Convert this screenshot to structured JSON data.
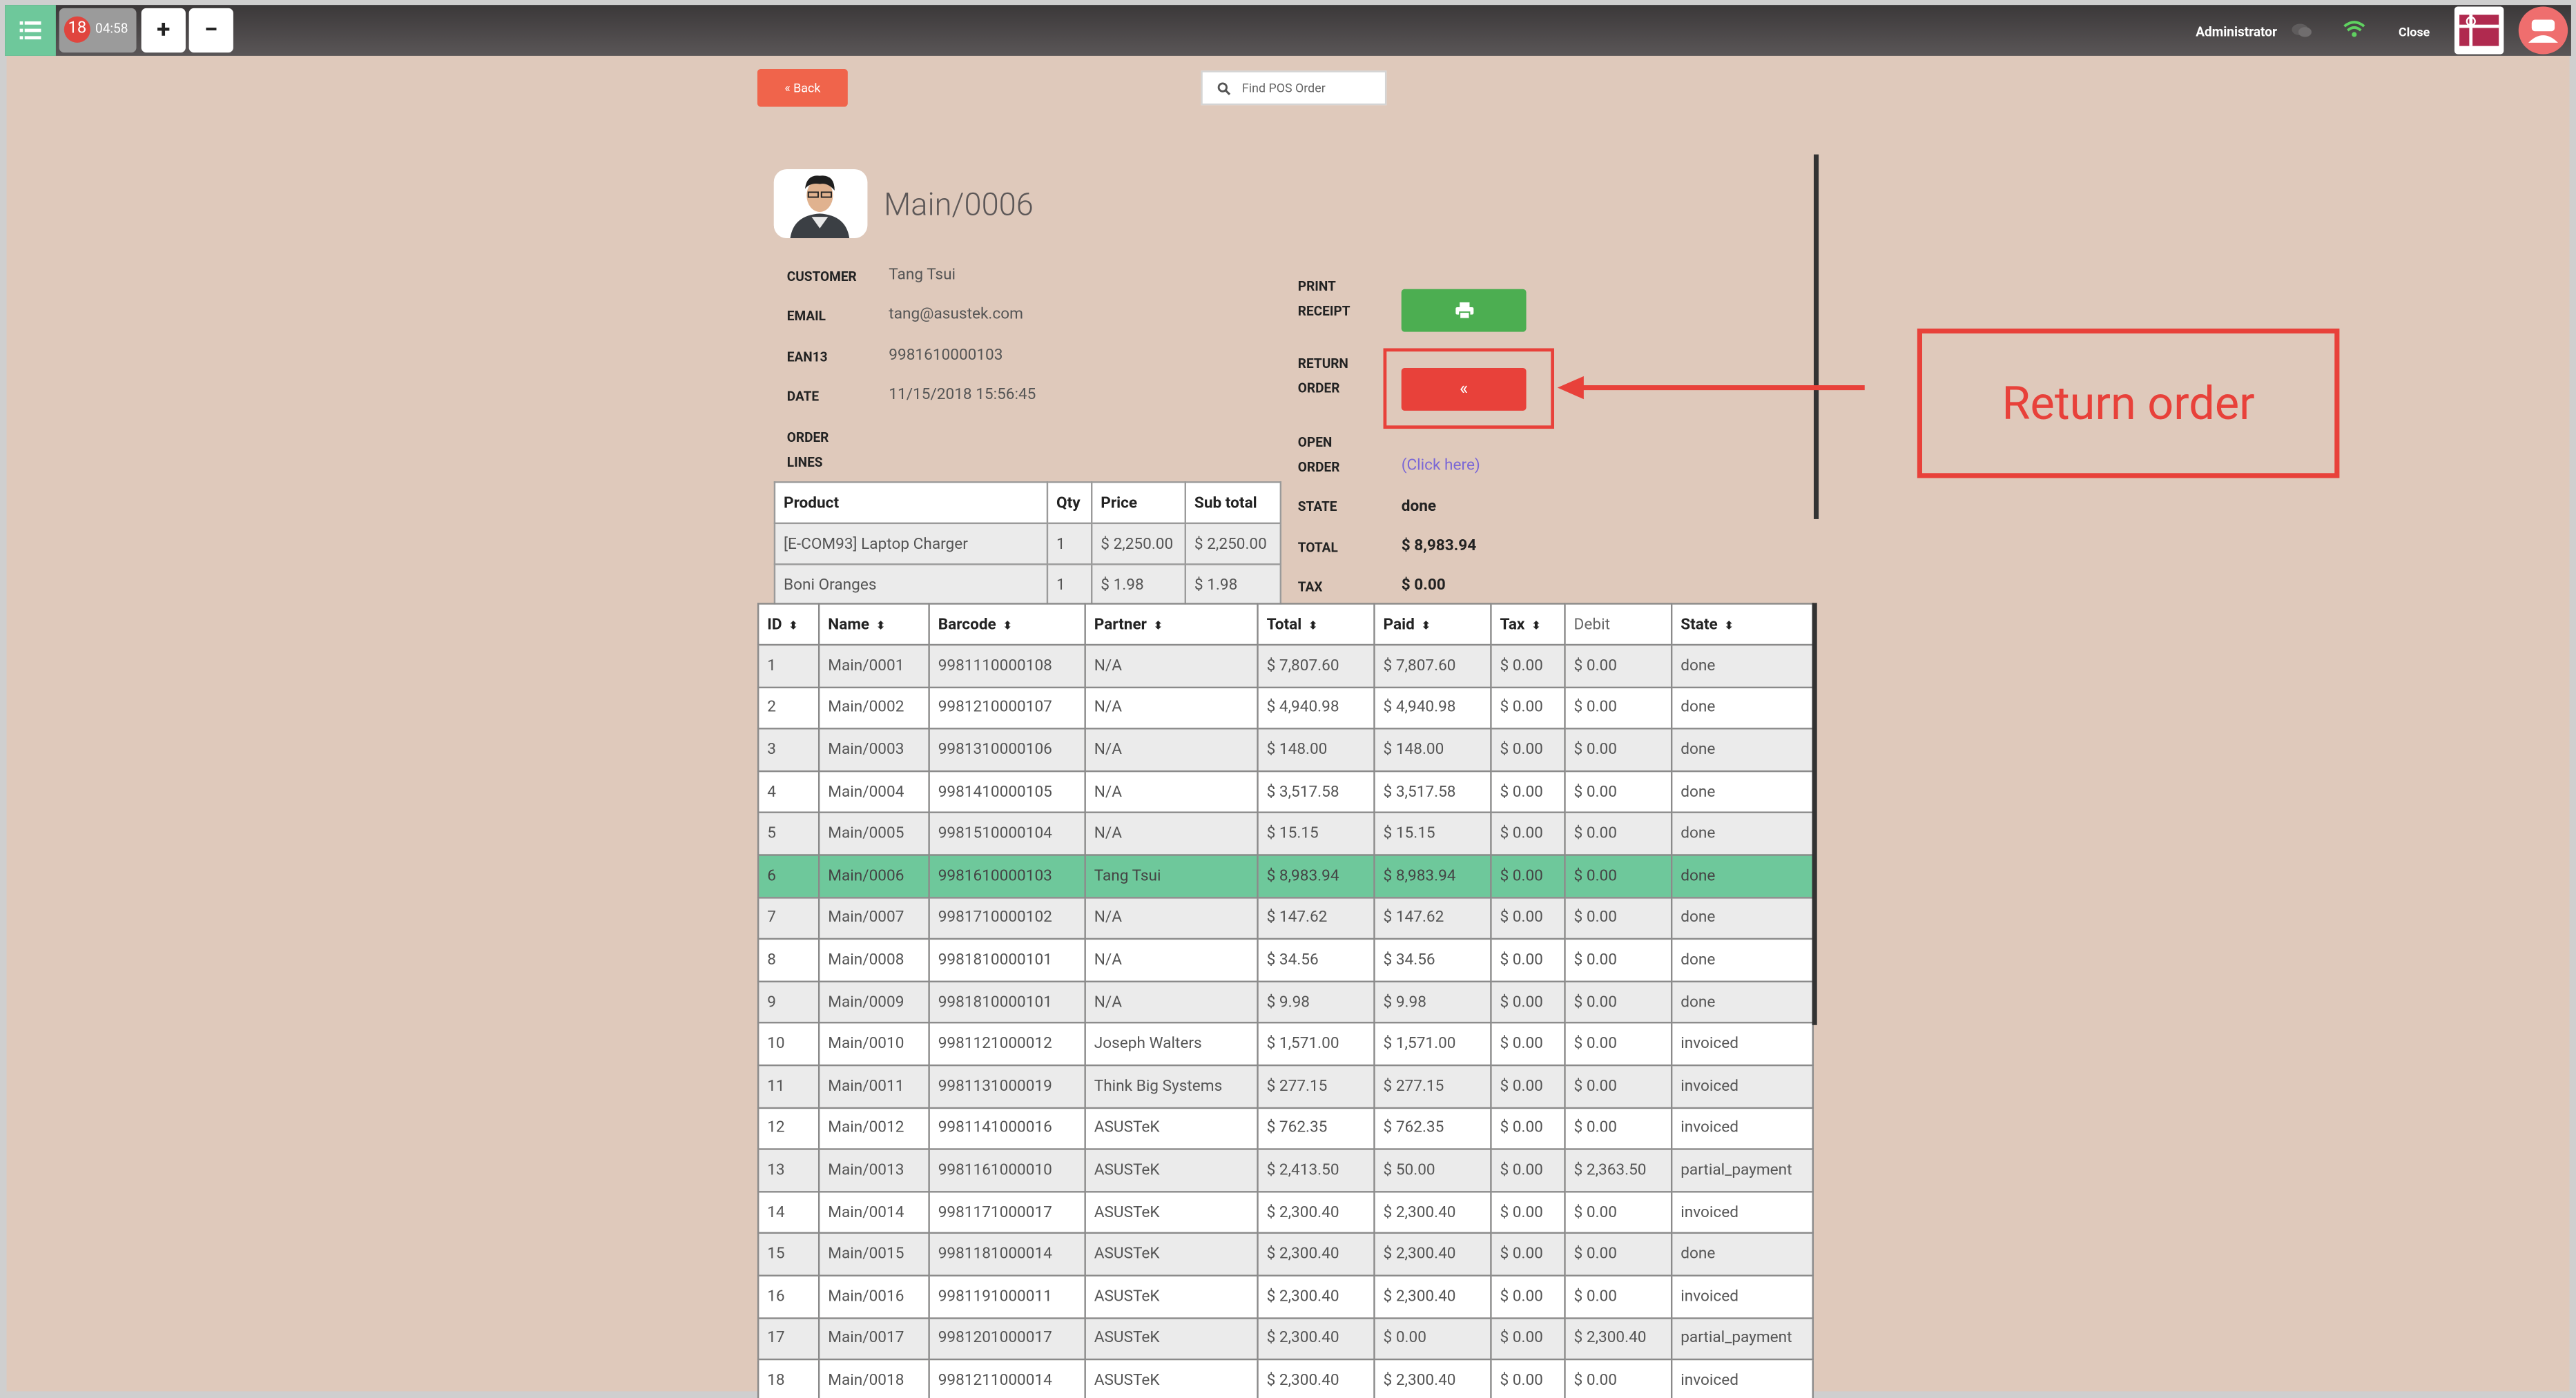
{
  "topbar": {
    "order_count": "18",
    "order_time": "04:58",
    "plus": "+",
    "minus": "−",
    "user": "Administrator",
    "close": "Close"
  },
  "nav": {
    "back": "« Back",
    "search_placeholder": "Find POS Order"
  },
  "order": {
    "title": "Main/0006",
    "customer_label": "CUSTOMER",
    "customer": "Tang Tsui",
    "email_label": "EMAIL",
    "email": "tang@asustek.com",
    "ean_label": "EAN13",
    "ean": "9981610000103",
    "date_label": "DATE",
    "date": "11/15/2018 15:56:45",
    "lines_label_1": "ORDER",
    "lines_label_2": "LINES",
    "print_label_1": "PRINT",
    "print_label_2": "RECEIPT",
    "return_label_1": "RETURN",
    "return_label_2": "ORDER",
    "return_glyph": "«",
    "open_label_1": "OPEN",
    "open_label_2": "ORDER",
    "open_link": "(Click here)",
    "state_label": "STATE",
    "state": "done",
    "total_label": "TOTAL",
    "total": "$ 8,983.94",
    "tax_label": "TAX",
    "tax": "$ 0.00"
  },
  "order_lines": {
    "headers": [
      "Product",
      "Qty",
      "Price",
      "Sub total"
    ],
    "rows": [
      [
        "[E-COM93] Laptop Charger",
        "1",
        "$ 2,250.00",
        "$ 2,250.00"
      ],
      [
        "Boni Oranges",
        "1",
        "$ 1.98",
        "$ 1.98"
      ]
    ]
  },
  "orders_table": {
    "headers": [
      "ID",
      "Name",
      "Barcode",
      "Partner",
      "Total",
      "Paid",
      "Tax",
      "Debit",
      "State"
    ],
    "rows": [
      [
        "1",
        "Main/0001",
        "9981110000108",
        "N/A",
        "$ 7,807.60",
        "$ 7,807.60",
        "$ 0.00",
        "$ 0.00",
        "done"
      ],
      [
        "2",
        "Main/0002",
        "9981210000107",
        "N/A",
        "$ 4,940.98",
        "$ 4,940.98",
        "$ 0.00",
        "$ 0.00",
        "done"
      ],
      [
        "3",
        "Main/0003",
        "9981310000106",
        "N/A",
        "$ 148.00",
        "$ 148.00",
        "$ 0.00",
        "$ 0.00",
        "done"
      ],
      [
        "4",
        "Main/0004",
        "9981410000105",
        "N/A",
        "$ 3,517.58",
        "$ 3,517.58",
        "$ 0.00",
        "$ 0.00",
        "done"
      ],
      [
        "5",
        "Main/0005",
        "9981510000104",
        "N/A",
        "$ 15.15",
        "$ 15.15",
        "$ 0.00",
        "$ 0.00",
        "done"
      ],
      [
        "6",
        "Main/0006",
        "9981610000103",
        "Tang Tsui",
        "$ 8,983.94",
        "$ 8,983.94",
        "$ 0.00",
        "$ 0.00",
        "done"
      ],
      [
        "7",
        "Main/0007",
        "9981710000102",
        "N/A",
        "$ 147.62",
        "$ 147.62",
        "$ 0.00",
        "$ 0.00",
        "done"
      ],
      [
        "8",
        "Main/0008",
        "9981810000101",
        "N/A",
        "$ 34.56",
        "$ 34.56",
        "$ 0.00",
        "$ 0.00",
        "done"
      ],
      [
        "9",
        "Main/0009",
        "9981810000101",
        "N/A",
        "$ 9.98",
        "$ 9.98",
        "$ 0.00",
        "$ 0.00",
        "done"
      ],
      [
        "10",
        "Main/0010",
        "9981121000012",
        "Joseph Walters",
        "$ 1,571.00",
        "$ 1,571.00",
        "$ 0.00",
        "$ 0.00",
        "invoiced"
      ],
      [
        "11",
        "Main/0011",
        "9981131000019",
        "Think Big Systems",
        "$ 277.15",
        "$ 277.15",
        "$ 0.00",
        "$ 0.00",
        "invoiced"
      ],
      [
        "12",
        "Main/0012",
        "9981141000016",
        "ASUSTeK",
        "$ 762.35",
        "$ 762.35",
        "$ 0.00",
        "$ 0.00",
        "invoiced"
      ],
      [
        "13",
        "Main/0013",
        "9981161000010",
        "ASUSTeK",
        "$ 2,413.50",
        "$ 50.00",
        "$ 0.00",
        "$ 2,363.50",
        "partial_payment"
      ],
      [
        "14",
        "Main/0014",
        "9981171000017",
        "ASUSTeK",
        "$ 2,300.40",
        "$ 2,300.40",
        "$ 0.00",
        "$ 0.00",
        "invoiced"
      ],
      [
        "15",
        "Main/0015",
        "9981181000014",
        "ASUSTeK",
        "$ 2,300.40",
        "$ 2,300.40",
        "$ 0.00",
        "$ 0.00",
        "done"
      ],
      [
        "16",
        "Main/0016",
        "9981191000011",
        "ASUSTeK",
        "$ 2,300.40",
        "$ 2,300.40",
        "$ 0.00",
        "$ 0.00",
        "invoiced"
      ],
      [
        "17",
        "Main/0017",
        "9981201000017",
        "ASUSTeK",
        "$ 2,300.40",
        "$ 0.00",
        "$ 0.00",
        "$ 2,300.40",
        "partial_payment"
      ],
      [
        "18",
        "Main/0018",
        "9981211000014",
        "ASUSTeK",
        "$ 2,300.40",
        "$ 2,300.40",
        "$ 0.00",
        "$ 0.00",
        "invoiced"
      ]
    ],
    "selected_row": 5
  },
  "annotation": {
    "callout_text": "Return order"
  },
  "colors": {
    "background": "#dfc9bb",
    "accent_green": "#6ec89b",
    "print_green": "#4cae51",
    "danger_red": "#e8413a",
    "back_orange": "#f0644b"
  }
}
